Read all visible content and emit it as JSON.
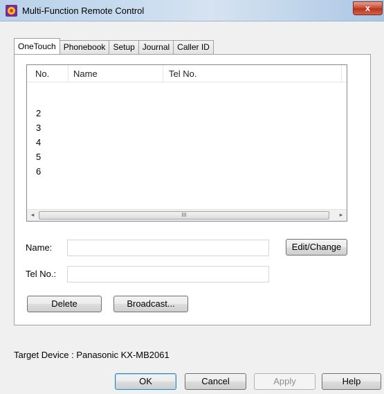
{
  "window": {
    "title": "Multi-Function Remote Control",
    "close_label": "x"
  },
  "tabs": [
    {
      "label": "OneTouch",
      "active": true
    },
    {
      "label": "Phonebook",
      "active": false
    },
    {
      "label": "Setup",
      "active": false
    },
    {
      "label": "Journal",
      "active": false
    },
    {
      "label": "Caller ID",
      "active": false
    }
  ],
  "list": {
    "columns": [
      "No.",
      "Name",
      "Tel No."
    ],
    "rows": [
      {
        "no": "2"
      },
      {
        "no": "3"
      },
      {
        "no": "4"
      },
      {
        "no": "5"
      },
      {
        "no": "6"
      }
    ],
    "scroll_left": "◂",
    "scroll_right": "▸",
    "scroll_grip": "III"
  },
  "form": {
    "name_label": "Name:",
    "name_value": "",
    "tel_label": "Tel No.:",
    "tel_value": "",
    "edit_button": "Edit/Change",
    "delete_button": "Delete",
    "broadcast_button": "Broadcast..."
  },
  "footer": {
    "target_device": "Target Device : Panasonic KX-MB2061",
    "ok": "OK",
    "cancel": "Cancel",
    "apply": "Apply",
    "help": "Help"
  },
  "colors": {
    "titlebar": "#c9dcef",
    "close_button": "#c7462f",
    "default_button_border": "#3c7fb1"
  }
}
